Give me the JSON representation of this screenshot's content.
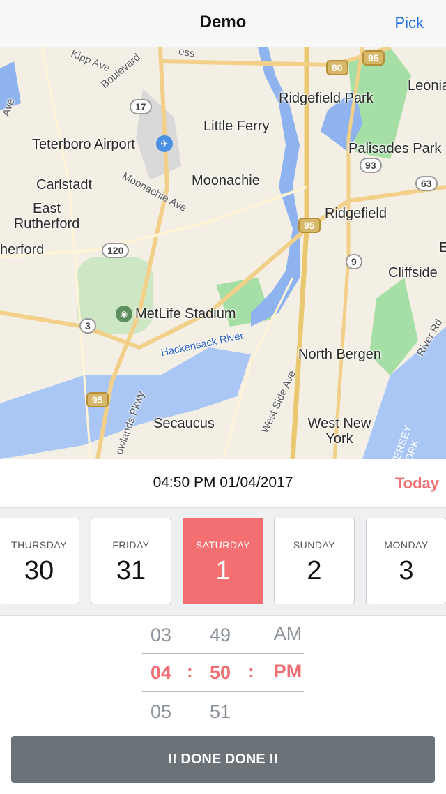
{
  "navbar": {
    "title": "Demo",
    "pick_label": "Pick"
  },
  "map": {
    "places": {
      "teterboro": "Teterboro Airport",
      "little_ferry": "Little Ferry",
      "ridgefield_park": "Ridgefield Park",
      "leonia": "Leonia",
      "palisades_park": "Palisades Park",
      "carlstadt": "Carlstadt",
      "moonachie": "Moonachie",
      "east_rutherford": "East Rutherford",
      "rutherford": "herford",
      "ridgefield": "Ridgefield",
      "cliffside": "Cliffside",
      "metlife": "MetLife Stadium",
      "north_bergen": "North Bergen",
      "secaucus": "Secaucus",
      "west_new_york": "West New York"
    },
    "streets": {
      "kipp": "Kipp Ave",
      "boulevard": "Boulevard",
      "moonachie_ave": "Moonachie Ave",
      "hackensack": "Hackensack River",
      "west_side": "West Side Ave",
      "river_rd": "River Rd",
      "meadowlands": "owlands Pkwy",
      "ess": "ess",
      "ave": "Ave",
      "jersey_york": "JERSEY\nYORK",
      "edge_e": "E"
    },
    "shields": [
      "95",
      "80",
      "17",
      "93",
      "63",
      "120",
      "95",
      "9",
      "3",
      "95"
    ]
  },
  "header": {
    "selected_datetime": "04:50 PM 01/04/2017",
    "today_label": "Today"
  },
  "days": [
    {
      "name": "THURSDAY",
      "num": "30"
    },
    {
      "name": "FRIDAY",
      "num": "31"
    },
    {
      "name": "SATURDAY",
      "num": "1"
    },
    {
      "name": "SUNDAY",
      "num": "2"
    },
    {
      "name": "MONDAY",
      "num": "3"
    }
  ],
  "time": {
    "hours": [
      "03",
      "04",
      "05"
    ],
    "minutes": [
      "49",
      "50",
      "51"
    ],
    "ampm": [
      "AM",
      "PM"
    ],
    "separator": ":"
  },
  "done_label": "!! DONE DONE !!",
  "colors": {
    "accent": "#f06f73",
    "link": "#1f6fe6",
    "done_bg": "#6b7278"
  }
}
